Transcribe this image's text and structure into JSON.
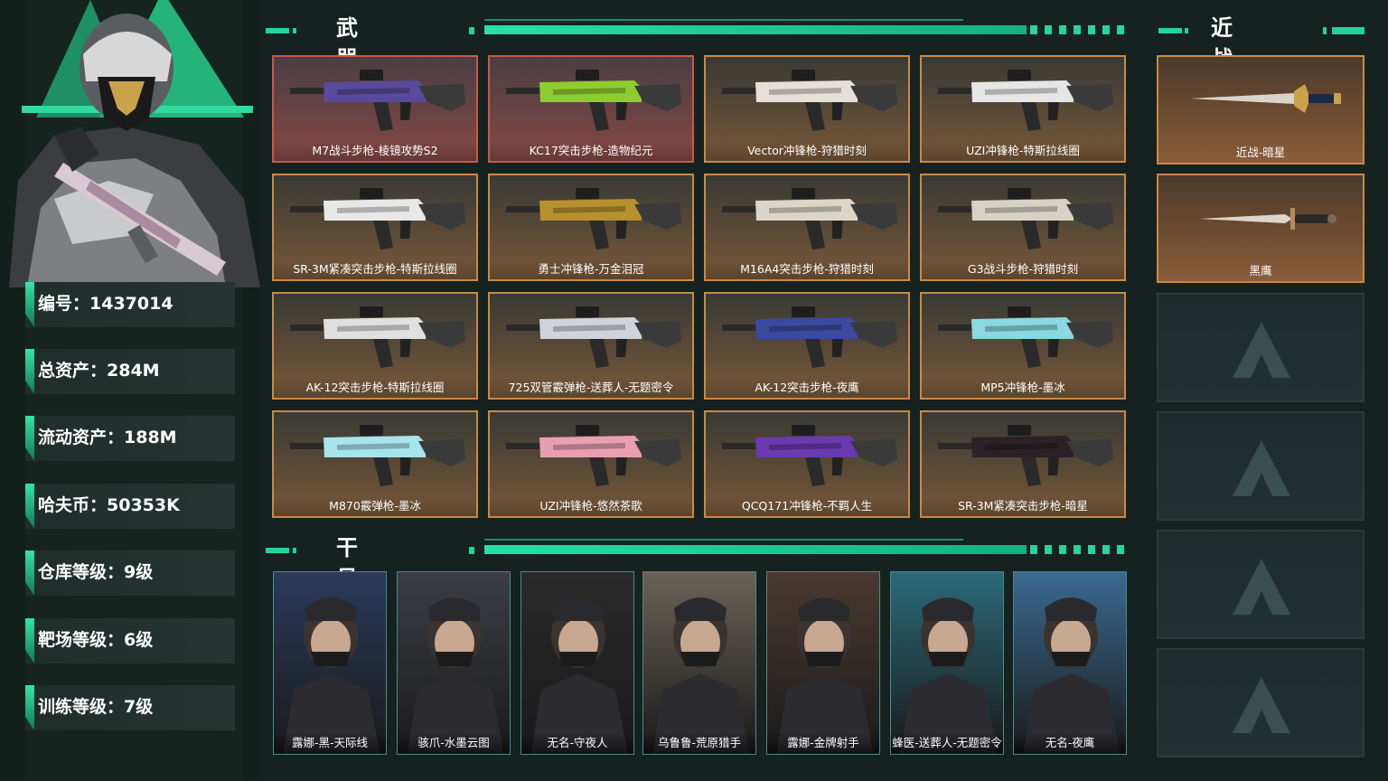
{
  "colors": {
    "accent": "#22d49a",
    "card_border_gold": "#c98a45",
    "card_border_red": "#c85a4a",
    "background": "#16221f"
  },
  "profile": {
    "stats": [
      {
        "label": "编号：1437014"
      },
      {
        "label": "总资产：284M"
      },
      {
        "label": "流动资产：188M"
      },
      {
        "label": "哈夫币：50353K"
      },
      {
        "label": "仓库等级：9级"
      },
      {
        "label": "靶场等级：6级"
      },
      {
        "label": "训练等级：7级"
      }
    ]
  },
  "weapon_section": {
    "title": "武器皮肤"
  },
  "weapons": [
    {
      "name": "M7战斗步枪-棱镜攻势S2",
      "rarity": "red",
      "tint": "#5a4a9a"
    },
    {
      "name": "KC17突击步枪-造物纪元",
      "rarity": "red",
      "tint": "#8fcc2e"
    },
    {
      "name": "Vector冲锋枪-狩猎时刻",
      "rarity": "gold",
      "tint": "#e5e0d8"
    },
    {
      "name": "UZI冲锋枪-特斯拉线圈",
      "rarity": "gold",
      "tint": "#e6e6e6"
    },
    {
      "name": "SR-3M紧凑突击步枪-特斯拉线圈",
      "rarity": "gold",
      "tint": "#e8e8e8"
    },
    {
      "name": "勇士冲锋枪-万金泪冠",
      "rarity": "gold",
      "tint": "#b8902e"
    },
    {
      "name": "M16A4突击步枪-狩猎时刻",
      "rarity": "gold",
      "tint": "#dcd6c8"
    },
    {
      "name": "G3战斗步枪-狩猎时刻",
      "rarity": "gold",
      "tint": "#d8d2c6"
    },
    {
      "name": "AK-12突击步枪-特斯拉线圈",
      "rarity": "gold",
      "tint": "#e0e0e0"
    },
    {
      "name": "725双管霰弹枪-送葬人-无题密令",
      "rarity": "gold",
      "tint": "#d0d4da"
    },
    {
      "name": "AK-12突击步枪-夜鹰",
      "rarity": "gold",
      "tint": "#3a4aa0"
    },
    {
      "name": "MP5冲锋枪-墨冰",
      "rarity": "gold",
      "tint": "#8ad8e0"
    },
    {
      "name": "M870霰弹枪-墨冰",
      "rarity": "gold",
      "tint": "#a8e4ec"
    },
    {
      "name": "UZI冲锋枪-悠然茶歌",
      "rarity": "gold",
      "tint": "#e8a0b0"
    },
    {
      "name": "QCQ171冲锋枪-不羁人生",
      "rarity": "gold",
      "tint": "#6a3ab0"
    },
    {
      "name": "SR-3M紧凑突击步枪-暗星",
      "rarity": "gold",
      "tint": "#2a2226"
    }
  ],
  "operator_section": {
    "title": "干员皮肤"
  },
  "operators": [
    {
      "name": "露娜-黑-天际线",
      "bg": "#2a3a5a"
    },
    {
      "name": "骇爪-水墨云图",
      "bg": "#3a3e44"
    },
    {
      "name": "无名-守夜人",
      "bg": "#2a2a2a"
    },
    {
      "name": "乌鲁鲁-荒原猎手",
      "bg": "#6a6258"
    },
    {
      "name": "露娜-金牌射手",
      "bg": "#4a3a30"
    },
    {
      "name": "蜂医-送葬人-无题密令",
      "bg": "#2a6a78"
    },
    {
      "name": "无名-夜鹰",
      "bg": "#3a6a90"
    }
  ],
  "melee_section": {
    "title": "近战皮肤"
  },
  "melee": [
    {
      "name": "近战-暗星"
    },
    {
      "name": "黑鹰"
    }
  ]
}
